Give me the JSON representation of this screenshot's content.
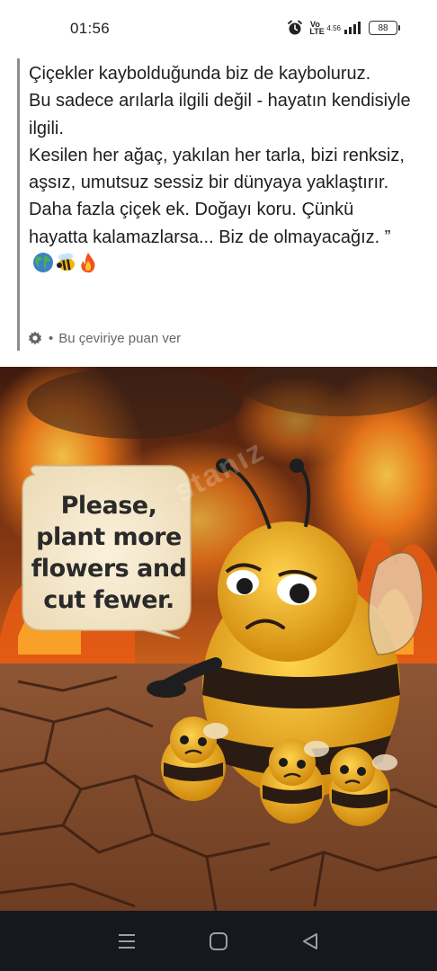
{
  "status_bar": {
    "time": "01:56",
    "volte_top": "Vo",
    "volte_bottom": "LTE",
    "net_speed": "4.56",
    "battery": "88",
    "icons": [
      "alarm-icon",
      "volte-icon",
      "signal-icon",
      "battery-icon"
    ]
  },
  "post": {
    "lines": [
      "Çiçekler kaybolduğunda biz de kayboluruz.",
      "Bu sadece arılarla ilgili değil - hayatın kendisiyle ilgili.",
      "Kesilen her ağaç, yakılan her tarla, bizi renksiz, aşsız, umutsuz sessiz bir dünyaya yaklaştırır.",
      "Daha fazla çiçek ek. Doğayı koru. Çünkü hayatta kalamazlarsa... Biz de olmayacağız. ”"
    ],
    "emojis": [
      "earth-globe-emoji",
      "bee-emoji",
      "fire-emoji"
    ],
    "translation_rating": "Bu çeviriye puan ver",
    "separator": "•"
  },
  "image": {
    "bubble_text": [
      "Please,",
      "plant more",
      "flowers and",
      "cut fewer."
    ],
    "watermark": "stanız",
    "colors": {
      "fire": "#e8631b",
      "sky": "#5b2b14",
      "ground": "#8a4a28",
      "bee": "#f0b020"
    }
  },
  "nav_bar": {
    "buttons": [
      "menu-icon",
      "home-icon",
      "back-icon"
    ]
  }
}
